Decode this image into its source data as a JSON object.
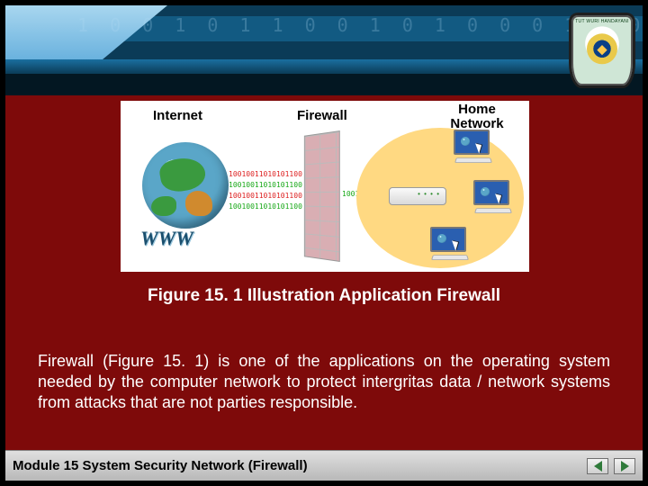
{
  "crest_label": "TUT WURI HANDAYANI",
  "illustration": {
    "label_internet": "Internet",
    "label_firewall": "Firewall",
    "label_home_network": "Home\nNetwork",
    "www": "WWW",
    "stream_bits": "1001001101010110011"
  },
  "caption": "Figure 15. 1 Illustration Application Firewall",
  "body": "Firewall (Figure 15. 1) is one of the applications on the operating system needed by the computer network to protect intergritas data / network systems from attacks that are not parties responsible.",
  "footer": "Module 15 System Security Network (Firewall)"
}
